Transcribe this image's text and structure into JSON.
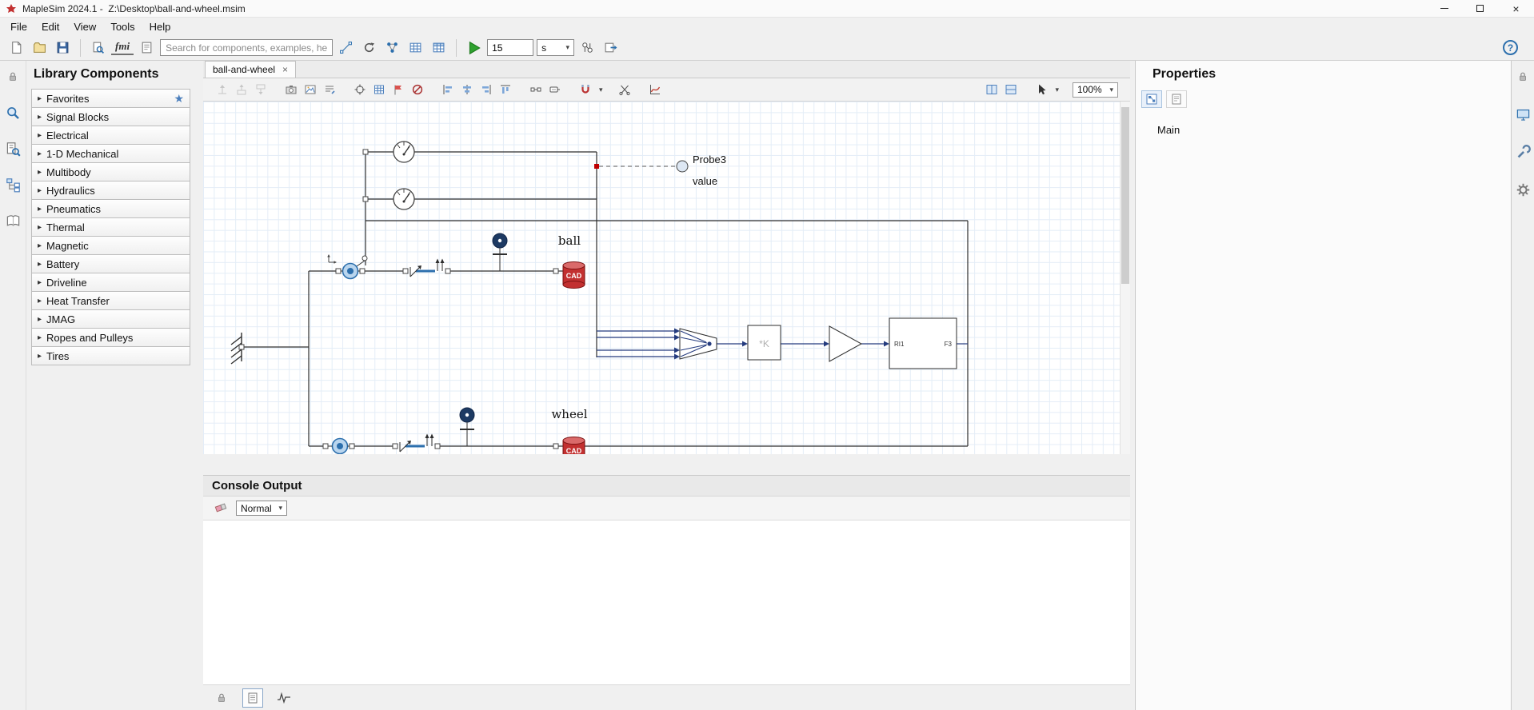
{
  "window": {
    "title": "MapleSim 2024.1 -  Z:\\Desktop\\ball-and-wheel.msim"
  },
  "menu": {
    "items": [
      "File",
      "Edit",
      "View",
      "Tools",
      "Help"
    ]
  },
  "toolbar": {
    "search_placeholder": "Search for components, examples, help...",
    "fmi_label": "fmi",
    "run_time": "15",
    "time_unit": "s"
  },
  "icons": {
    "expand": "▸",
    "star": "★",
    "caret": "▾",
    "close": "×",
    "help": "?"
  },
  "library": {
    "title": "Library Components",
    "items": [
      "Favorites",
      "Signal Blocks",
      "Electrical",
      "1-D Mechanical",
      "Multibody",
      "Hydraulics",
      "Pneumatics",
      "Thermal",
      "Magnetic",
      "Battery",
      "Driveline",
      "Heat Transfer",
      "JMAG",
      "Ropes and Pulleys",
      "Tires"
    ]
  },
  "tab": {
    "label": "ball-and-wheel"
  },
  "canvas_toolbar": {
    "zoom": "100%"
  },
  "diagram": {
    "probe": "Probe3",
    "probe_value": "value",
    "ball": "ball",
    "wheel": "wheel",
    "gain": "*K",
    "block_left": "RI1",
    "block_right": "F3",
    "cad": "CAD"
  },
  "console": {
    "title": "Console Output",
    "level": "Normal"
  },
  "properties": {
    "title": "Properties",
    "main": "Main"
  }
}
